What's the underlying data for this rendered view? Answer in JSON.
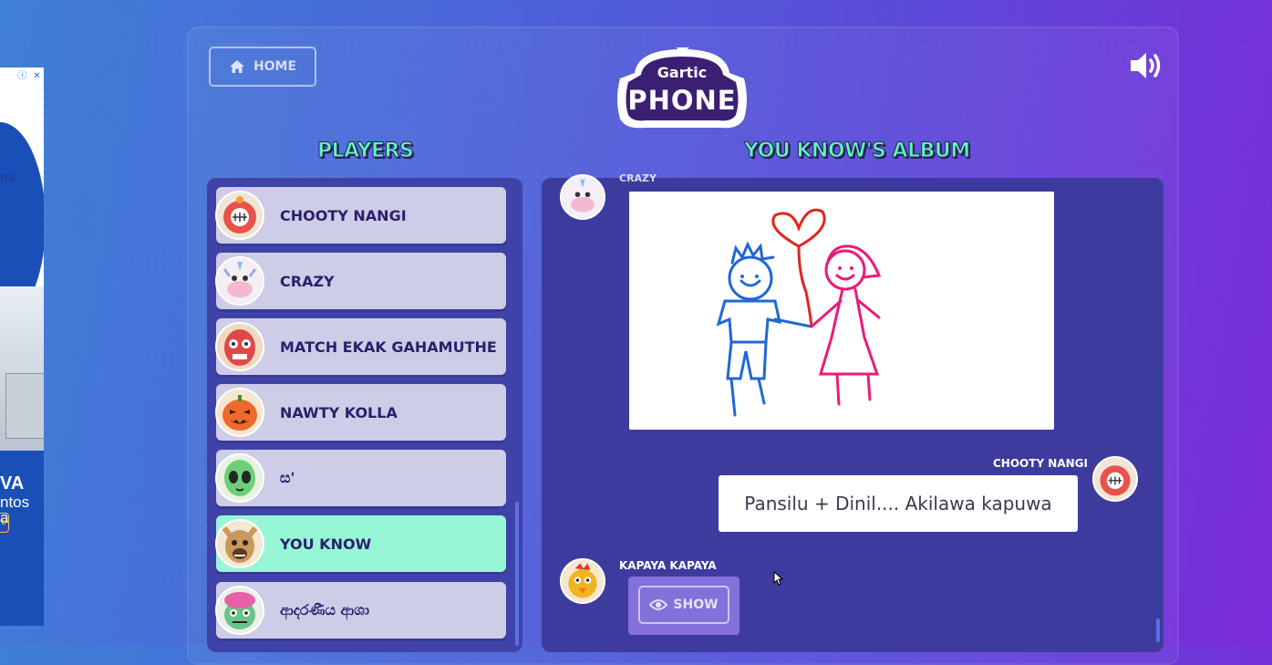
{
  "ad": {
    "badge_info": "ⓘ",
    "badge_close": "✕",
    "text_top": "na",
    "text_big": "VA",
    "text_mid": "ntos",
    "text_low": "a",
    "cta": "5"
  },
  "header": {
    "home_label": "HOME"
  },
  "logo": {
    "line1": "Gartic",
    "line2": "PHONE"
  },
  "players": {
    "heading": "PLAYERS",
    "items": [
      {
        "name": "CHOOTY NANGI",
        "active": false,
        "avatar": "red-bomb-avatar"
      },
      {
        "name": "CRAZY",
        "active": false,
        "avatar": "unicorn-avatar"
      },
      {
        "name": "MATCH EKAK GAHAMUTHE",
        "active": false,
        "avatar": "luchador-avatar"
      },
      {
        "name": "NAWTY KOLLA",
        "active": false,
        "avatar": "pumpkin-avatar"
      },
      {
        "name": "ස'",
        "active": false,
        "avatar": "alien-avatar"
      },
      {
        "name": "YOU KNOW",
        "active": true,
        "avatar": "llama-avatar"
      },
      {
        "name": "ආදරණීය ආශා",
        "active": false,
        "avatar": "brain-zombie-avatar"
      }
    ]
  },
  "album": {
    "heading": "YOU KNOW'S ALBUM",
    "entries": [
      {
        "user": "CRAZY",
        "type": "drawing",
        "content": "stick-figure-couple-with-heart-balloon"
      },
      {
        "user": "CHOOTY NANGI",
        "type": "text",
        "content": "Pansilu + Dinil.... Akilawa kapuwa"
      },
      {
        "user": "KAPAYA KAPAYA",
        "type": "hidden",
        "button": "SHOW"
      }
    ]
  },
  "colors": {
    "heading": "#5ef7b6",
    "active_row": "#96f6d6",
    "row": "#cdcde8",
    "panel": "#3f43a8"
  }
}
